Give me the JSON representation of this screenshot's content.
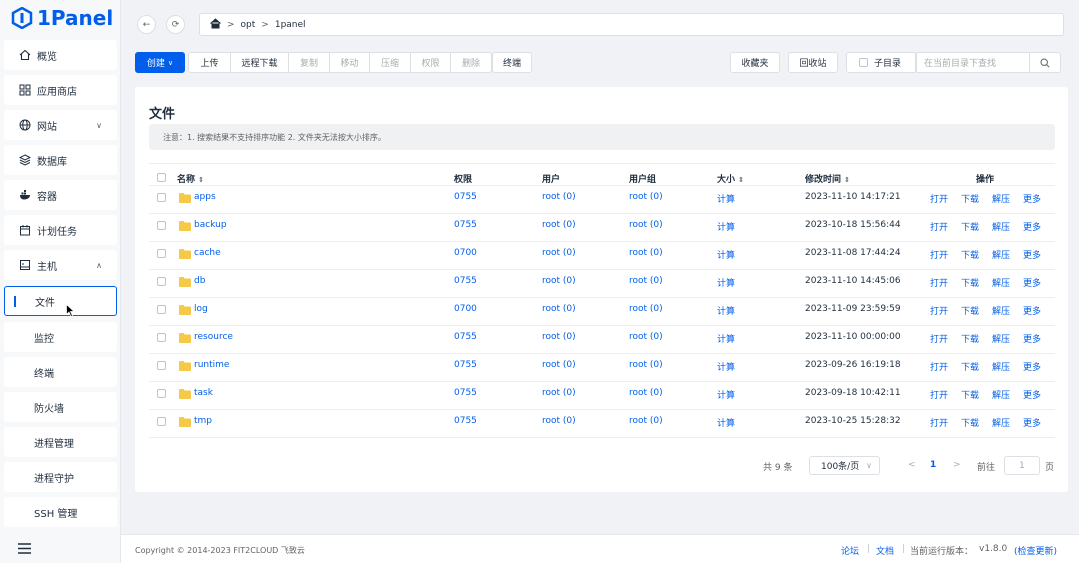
{
  "app": {
    "name": "1Panel",
    "brand_color": "#005eeb"
  },
  "sidebar": {
    "items": [
      {
        "label": "概览",
        "icon": "home-icon"
      },
      {
        "label": "应用商店",
        "icon": "grid-icon"
      },
      {
        "label": "网站",
        "icon": "globe-icon"
      },
      {
        "label": "数据库",
        "icon": "database-icon"
      },
      {
        "label": "容器",
        "icon": "docker-icon"
      },
      {
        "label": "计划任务",
        "icon": "calendar-icon"
      },
      {
        "label": "主机",
        "icon": "host-icon"
      }
    ],
    "host_sub": [
      {
        "label": "文件",
        "active": true
      },
      {
        "label": "监控"
      },
      {
        "label": "终端"
      },
      {
        "label": "防火墙"
      },
      {
        "label": "进程管理"
      },
      {
        "label": "进程守护"
      },
      {
        "label": "SSH 管理"
      }
    ]
  },
  "path": {
    "segments": [
      "opt",
      "1panel"
    ]
  },
  "toolbar": {
    "create": "创建",
    "upload": "上传",
    "remote_download": "远程下载",
    "copy": "复制",
    "move": "移动",
    "compress": "压缩",
    "permission": "权限",
    "delete": "删除",
    "terminal": "终端",
    "favorites": "收藏夹",
    "recycle_bin": "回收站",
    "subdir": "子目录",
    "search_placeholder": "在当前目录下查找"
  },
  "card": {
    "title": "文件",
    "notice": "注意：1. 搜索结果不支持排序功能 2. 文件夹无法按大小排序。"
  },
  "table": {
    "headers": {
      "name": "名称",
      "perm": "权限",
      "user": "用户",
      "group": "用户组",
      "size": "大小",
      "mtime": "修改时间",
      "ops": "操作"
    },
    "rows": [
      {
        "name": "apps",
        "perm": "0755",
        "user": "root (0)",
        "group": "root (0)",
        "size": "计算",
        "mtime": "2023-11-10 14:17:21"
      },
      {
        "name": "backup",
        "perm": "0755",
        "user": "root (0)",
        "group": "root (0)",
        "size": "计算",
        "mtime": "2023-10-18 15:56:44"
      },
      {
        "name": "cache",
        "perm": "0700",
        "user": "root (0)",
        "group": "root (0)",
        "size": "计算",
        "mtime": "2023-11-08 17:44:24"
      },
      {
        "name": "db",
        "perm": "0755",
        "user": "root (0)",
        "group": "root (0)",
        "size": "计算",
        "mtime": "2023-11-10 14:45:06"
      },
      {
        "name": "log",
        "perm": "0700",
        "user": "root (0)",
        "group": "root (0)",
        "size": "计算",
        "mtime": "2023-11-09 23:59:59"
      },
      {
        "name": "resource",
        "perm": "0755",
        "user": "root (0)",
        "group": "root (0)",
        "size": "计算",
        "mtime": "2023-11-10 00:00:00"
      },
      {
        "name": "runtime",
        "perm": "0755",
        "user": "root (0)",
        "group": "root (0)",
        "size": "计算",
        "mtime": "2023-09-26 16:19:18"
      },
      {
        "name": "task",
        "perm": "0755",
        "user": "root (0)",
        "group": "root (0)",
        "size": "计算",
        "mtime": "2023-09-18 10:42:11"
      },
      {
        "name": "tmp",
        "perm": "0755",
        "user": "root (0)",
        "group": "root (0)",
        "size": "计算",
        "mtime": "2023-10-25 15:28:32"
      }
    ],
    "ops": [
      "打开",
      "下载",
      "解压",
      "更多"
    ]
  },
  "pagination": {
    "total": "共 9 条",
    "page_size": "100条/页",
    "current": "1",
    "goto": "前往",
    "goto_value": "1",
    "page_suffix": "页"
  },
  "footer": {
    "copyright": "Copyright © 2014-2023 FIT2CLOUD 飞致云",
    "forum": "论坛",
    "docs": "文档",
    "version_label": "当前运行版本：",
    "version": "v1.8.0",
    "check_update": "(检查更新)"
  }
}
